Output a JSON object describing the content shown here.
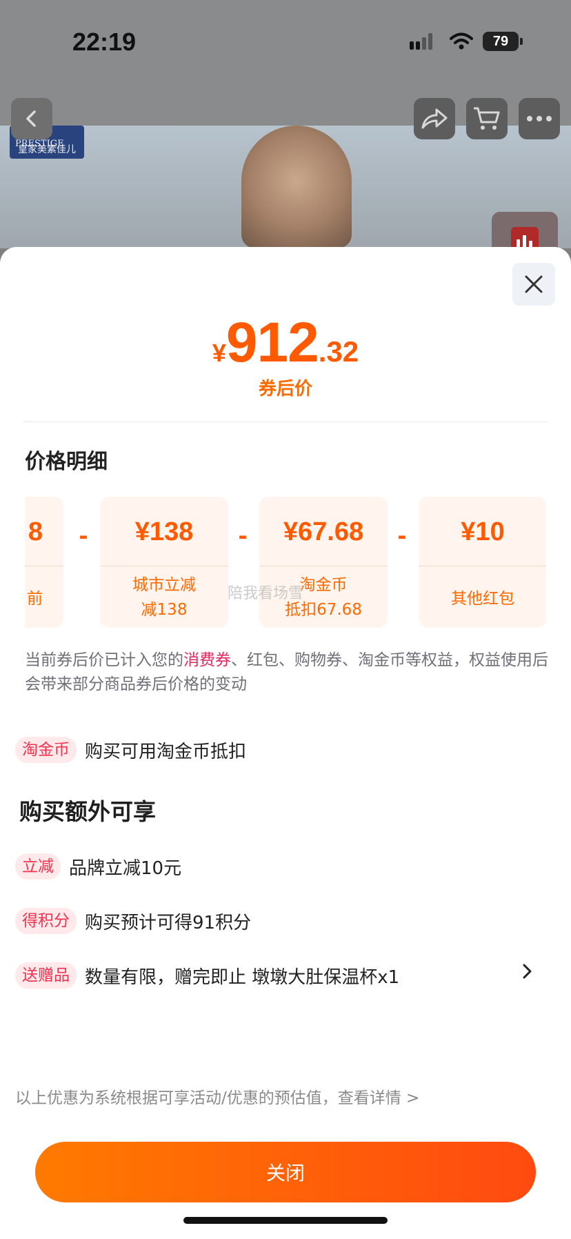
{
  "status_bar": {
    "time": "22:19",
    "battery": "79"
  },
  "header": {
    "brand_top": "Friso PRESTIGE",
    "brand_bottom": "皇家美素佳儿"
  },
  "sheet": {
    "price": {
      "currency": "¥",
      "integer": "912",
      "decimal": ".32"
    },
    "price_label": "券后价",
    "section_title": "价格明细",
    "cards": [
      {
        "amount": "8",
        "desc": "前"
      },
      {
        "amount": "¥138",
        "desc_line1": "城市立减",
        "desc_line2": "减138"
      },
      {
        "amount": "¥67.68",
        "desc_line1": "淘金币",
        "desc_line2": "抵扣67.68"
      },
      {
        "amount": "¥10",
        "desc": "其他红包"
      }
    ],
    "minus_sign": "-",
    "watermark": "陪我看场雪",
    "note": {
      "part1": "当前券后价已计入您的",
      "highlight": "消费券",
      "part2": "、红包、购物券、淘金币等权益，权益使用后会带来部分商品券后价格的变动"
    },
    "coin_row": {
      "tag": "淘金币",
      "text": "购买可用淘金币抵扣"
    },
    "extra_title": "购买额外可享",
    "extras": [
      {
        "tag": "立减",
        "text": "品牌立减10元"
      },
      {
        "tag": "得积分",
        "text": "购买预计可得91积分"
      },
      {
        "tag": "送赠品",
        "text": "数量有限，赠完即止 墩墩大肚保温杯x1"
      }
    ],
    "footer_note": "以上优惠为系统根据可享活动/优惠的预估值，查看详情 >",
    "close_label": "关闭"
  },
  "icons": [
    "back-icon",
    "share-icon",
    "cart-icon",
    "more-icon",
    "close-icon",
    "chevron-right-icon",
    "signal-icon",
    "wifi-icon"
  ]
}
